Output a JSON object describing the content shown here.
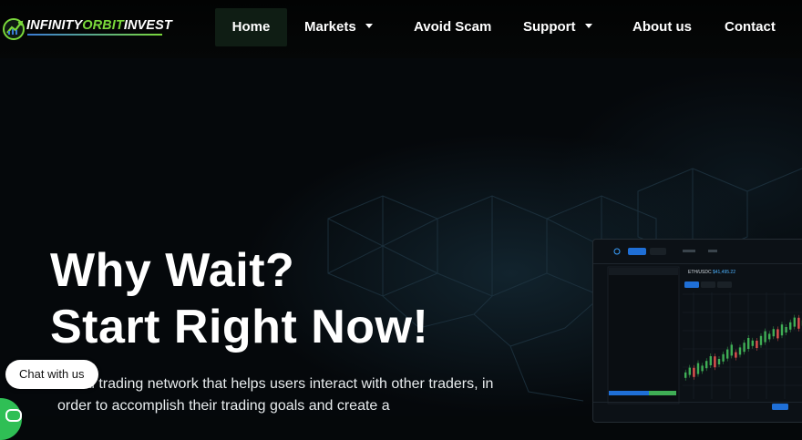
{
  "brand": {
    "name_part1": "INFINITY",
    "name_part2": "ORBIT",
    "name_part3": "INVEST",
    "primary_color": "#7ad83b",
    "accent_color": "#3a7bd5"
  },
  "nav": {
    "items": [
      {
        "label": "Home",
        "active": true,
        "has_dropdown": false
      },
      {
        "label": "Markets",
        "active": false,
        "has_dropdown": true
      },
      {
        "label": "Avoid Scam",
        "active": false,
        "has_dropdown": false
      },
      {
        "label": "Support",
        "active": false,
        "has_dropdown": true
      },
      {
        "label": "About us",
        "active": false,
        "has_dropdown": false
      },
      {
        "label": "Contact",
        "active": false,
        "has_dropdown": false
      }
    ]
  },
  "hero": {
    "title_line1": "Why Wait?",
    "title_line2": "Start Right Now!",
    "description": "social trading network that helps users interact with other traders, in order to accomplish their trading goals and create a"
  },
  "chat": {
    "label": "Chat with us",
    "launcher_color": "#2fbf55",
    "icon": "chat-bubble-icon"
  },
  "trading_preview": {
    "pair_label": "ETH/USDC",
    "price": "$41,495.22",
    "up_color": "#3fae55",
    "down_color": "#e0524f"
  }
}
